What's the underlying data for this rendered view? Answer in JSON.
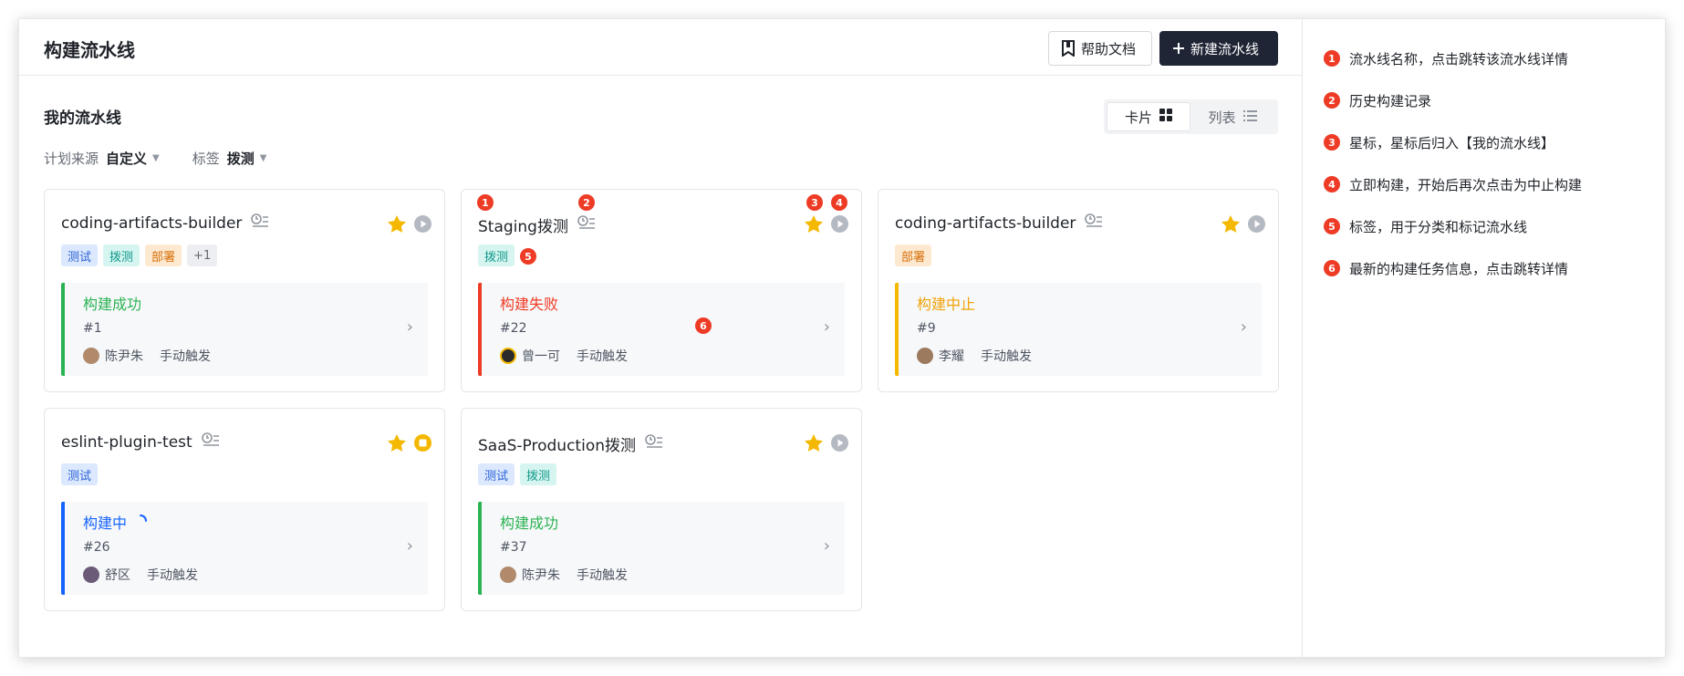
{
  "header": {
    "title": "构建流水线",
    "help_label": "帮助文档",
    "new_label": "新建流水线"
  },
  "section": {
    "title": "我的流水线"
  },
  "view_toggle": {
    "card_label": "卡片",
    "list_label": "列表",
    "active": "card"
  },
  "filters": [
    {
      "label": "计划来源",
      "value": "自定义"
    },
    {
      "label": "标签",
      "value": "拨测"
    }
  ],
  "cards": [
    {
      "name": "coding-artifacts-builder",
      "tags": [
        {
          "text": "测试",
          "kind": "test"
        },
        {
          "text": "拨测",
          "kind": "dial"
        },
        {
          "text": "部署",
          "kind": "deploy"
        },
        {
          "text": "+1",
          "kind": "more"
        }
      ],
      "action": "play",
      "job": {
        "status": "构建成功",
        "state": "success",
        "number": "#1",
        "user": "陈尹朱",
        "trigger": "手动触发"
      }
    },
    {
      "name": "Staging拨测",
      "tags": [
        {
          "text": "拨测",
          "kind": "dial"
        }
      ],
      "action": "play",
      "job": {
        "status": "构建失败",
        "state": "fail",
        "number": "#22",
        "user": "曾一可",
        "trigger": "手动触发"
      }
    },
    {
      "name": "coding-artifacts-builder",
      "tags": [
        {
          "text": "部署",
          "kind": "deploy"
        }
      ],
      "action": "play",
      "job": {
        "status": "构建中止",
        "state": "abort",
        "number": "#9",
        "user": "李耀",
        "trigger": "手动触发"
      }
    },
    {
      "name": "eslint-plugin-test",
      "tags": [
        {
          "text": "测试",
          "kind": "test"
        }
      ],
      "action": "stop",
      "job": {
        "status": "构建中",
        "state": "running",
        "number": "#26",
        "user": "舒区",
        "trigger": "手动触发"
      }
    },
    {
      "name": "SaaS-Production拨测",
      "tags": [
        {
          "text": "测试",
          "kind": "test"
        },
        {
          "text": "拨测",
          "kind": "dial"
        }
      ],
      "action": "play",
      "job": {
        "status": "构建成功",
        "state": "success",
        "number": "#37",
        "user": "陈尹朱",
        "trigger": "手动触发"
      }
    }
  ],
  "notes": [
    {
      "num": "1",
      "text": "流水线名称，点击跳转该流水线详情"
    },
    {
      "num": "2",
      "text": "历史构建记录"
    },
    {
      "num": "3",
      "text": "星标，星标后归入【我的流水线】"
    },
    {
      "num": "4",
      "text": "立即构建，开始后再次点击为中止构建"
    },
    {
      "num": "5",
      "text": "标签，用于分类和标记流水线"
    },
    {
      "num": "6",
      "text": "最新的构建任务信息，点击跳转详情"
    }
  ],
  "colors": {
    "success": "#2bb352",
    "fail": "#ee3b25",
    "abort": "#f5b800",
    "running": "#1664ff",
    "star": "#f5b800",
    "primary_button": "#1f2535",
    "marker": "#ee3b25"
  }
}
